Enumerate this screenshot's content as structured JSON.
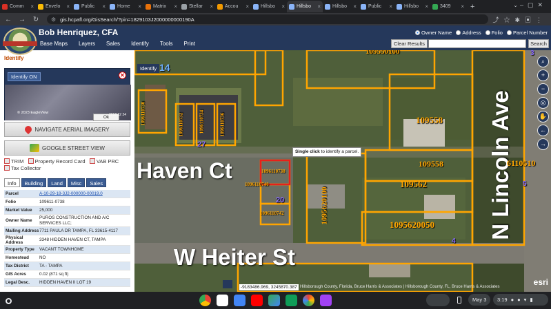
{
  "browser": {
    "tabs": [
      {
        "label": "Comm",
        "color": "#d93025"
      },
      {
        "label": "Envelo",
        "color": "#fbbc05"
      },
      {
        "label": "Public",
        "color": "#8ab4f8"
      },
      {
        "label": "Home",
        "color": "#8ab4f8"
      },
      {
        "label": "Matrix",
        "color": "#e8710a"
      },
      {
        "label": "Stellar",
        "color": "#9aa0a6"
      },
      {
        "label": "Accou",
        "color": "#f29900"
      },
      {
        "label": "Hillsbo",
        "color": "#8ab4f8"
      },
      {
        "label": "Hillsbo",
        "color": "#8ab4f8",
        "active": true
      },
      {
        "label": "Hillsbo",
        "color": "#8ab4f8"
      },
      {
        "label": "Public",
        "color": "#8ab4f8"
      },
      {
        "label": "Hillsbo",
        "color": "#8ab4f8"
      },
      {
        "label": "3409",
        "color": "#34a853"
      }
    ],
    "url": "gis.hcpafl.org/GisSearch/?pin=1829103J2000000000190A"
  },
  "header": {
    "title": "Bob Henriquez,  CFA",
    "menu": [
      "Base Maps",
      "Layers",
      "Sales",
      "Identify",
      "Tools",
      "Print"
    ],
    "search_options": [
      "Owner Name",
      "Address",
      "Folio",
      "Parcel Number"
    ],
    "clear_label": "Clear Results",
    "search_label": "Search"
  },
  "panel": {
    "title": "Identify",
    "identify_on": "Identify ON",
    "minimap_ok": "Ok",
    "minimap_copy": "© 2023 EagleView",
    "minimap_scale": "2018 12 24",
    "aerial_btn": "NAVIGATE AERIAL IMAGERY",
    "street_btn": "GOOGLE STREET VIEW",
    "links": [
      "TRIM",
      "Property Record Card",
      "VAB PRC",
      "Tax Collector"
    ],
    "tabs": [
      "Info",
      "Building",
      "Land",
      "Misc",
      "Sales"
    ],
    "rows": [
      {
        "k": "Parcel",
        "v": "A-10-29-18-3J2-000000-00019.0",
        "link": true
      },
      {
        "k": "Folio",
        "v": "109611-0738"
      },
      {
        "k": "Market Value",
        "v": "25,000"
      },
      {
        "k": "Owner Name",
        "v": "PUROS CONSTRUCTION AND A/C SERVICES LLC;"
      },
      {
        "k": "Mailing Address",
        "v": "7711 PAULA DR TAMPA, FL 33615-4117"
      },
      {
        "k": "Physical Address",
        "v": "3348 HIDDEN HAVEN CT, TAMPA"
      },
      {
        "k": "Property Type",
        "v": "VACANT TOWNHOME"
      },
      {
        "k": "Homestead",
        "v": "NO"
      },
      {
        "k": "Tax District",
        "v": "TA - TAMPA"
      },
      {
        "k": "GIS Acres",
        "v": "0.02 (871 sq ft)"
      },
      {
        "k": "Legal Desc.",
        "v": "HIDDEN HAVEN II LOT 19"
      }
    ]
  },
  "map": {
    "identify_tag": "Identify",
    "tooltip_bold": "Single click",
    "tooltip_rest": "to identify a parcel.",
    "coords": "-9183486.969, 3245870.387",
    "attribution": "Hillsborough County, Florida, Bruce Harris & Associates | Hillsborough County, FL, Bruce Harris & Associates",
    "esri": "esri",
    "labels": {
      "street1": "Haven Ct",
      "street2": "W Heiter St",
      "street3": "N Lincoln Ave",
      "p1": "109558",
      "p2": "109558",
      "p3": "109562",
      "p4": "1095620050",
      "p5": "1095620100",
      "p6": "6110510",
      "p7": "1096110738",
      "p8": "1096110740",
      "p9": "1096110742",
      "p10": "1096110730",
      "p11": "1096110732",
      "p12": "1096110734",
      "p13": "1096110736",
      "p14": "109550100",
      "n14": "14",
      "n20": "20",
      "n27": "27",
      "n4": "4",
      "n3": "3",
      "n5": "5"
    }
  },
  "shelf": {
    "date": "May 3",
    "time": "3:19"
  }
}
